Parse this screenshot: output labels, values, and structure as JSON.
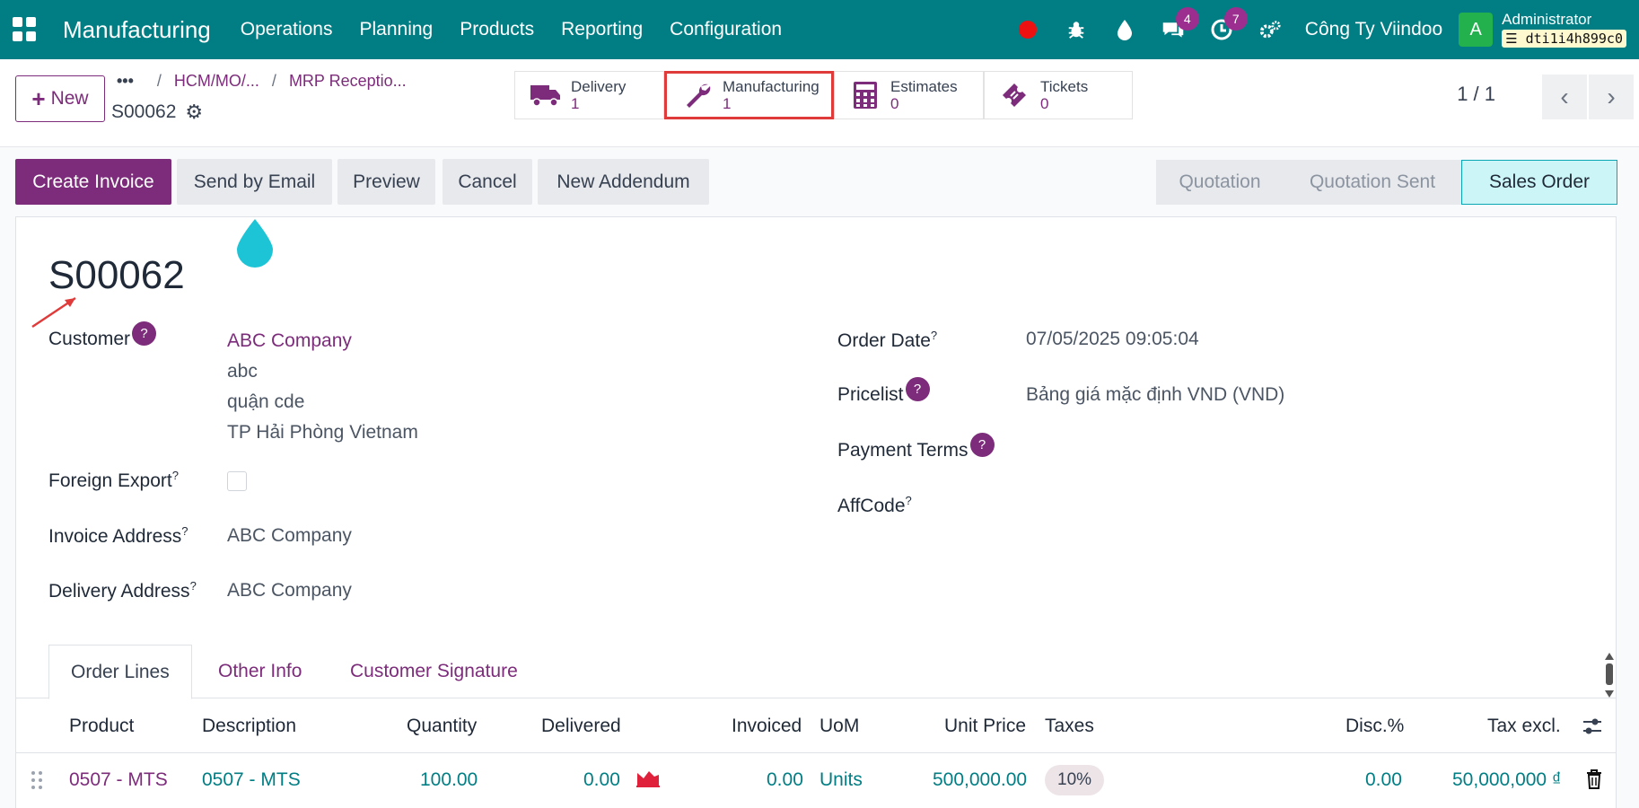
{
  "navbar": {
    "app_title": "Manufacturing",
    "menu": [
      "Operations",
      "Planning",
      "Products",
      "Reporting",
      "Configuration"
    ],
    "chat_badge": "4",
    "activity_badge": "7",
    "company": "Công Ty Viindoo",
    "avatar_letter": "A",
    "user": "Administrator",
    "database": "dti1i4h899c0"
  },
  "control": {
    "new_label": "New",
    "breadcrumb": [
      "HCM/MO/...",
      "MRP Receptio..."
    ],
    "record": "S00062",
    "pager": "1 / 1"
  },
  "smart_buttons": [
    {
      "label": "Delivery",
      "value": "1",
      "icon": "truck-icon"
    },
    {
      "label": "Manufacturing",
      "value": "1",
      "icon": "wrench-icon"
    },
    {
      "label": "Estimates",
      "value": "0",
      "icon": "calculator-icon"
    },
    {
      "label": "Tickets",
      "value": "0",
      "icon": "ticket-icon"
    }
  ],
  "actions": {
    "create_invoice": "Create Invoice",
    "send_email": "Send by Email",
    "preview": "Preview",
    "cancel": "Cancel",
    "new_addendum": "New Addendum"
  },
  "statusbar": [
    "Quotation",
    "Quotation Sent",
    "Sales Order"
  ],
  "form": {
    "title": "S00062",
    "customer_label": "Customer",
    "customer_name": "ABC Company",
    "customer_addr": [
      "abc",
      "quận cde",
      "TP Hải Phòng Vietnam"
    ],
    "foreign_export_label": "Foreign Export",
    "invoice_address_label": "Invoice Address",
    "invoice_address": "ABC Company",
    "delivery_address_label": "Delivery Address",
    "delivery_address": "ABC Company",
    "order_date_label": "Order Date",
    "order_date": "07/05/2025 09:05:04",
    "pricelist_label": "Pricelist",
    "pricelist": "Bảng giá mặc định VND (VND)",
    "payment_terms_label": "Payment Terms",
    "affcode_label": "AffCode",
    "help_mark": "?"
  },
  "tabs": [
    "Order Lines",
    "Other Info",
    "Customer Signature"
  ],
  "table": {
    "headers": [
      "Product",
      "Description",
      "Quantity",
      "Delivered",
      "Invoiced",
      "UoM",
      "Unit Price",
      "Taxes",
      "Disc.%",
      "Tax excl."
    ],
    "rows": [
      {
        "product": "0507 - MTS",
        "description": "0507 - MTS",
        "quantity": "100.00",
        "delivered": "0.00",
        "invoiced": "0.00",
        "uom": "Units",
        "unit_price": "500,000.00",
        "tax": "10%",
        "discount": "0.00",
        "subtotal": "50,000,000 ₫"
      }
    ]
  },
  "colors": {
    "navbar": "#017e84",
    "primary": "#7c2c7a",
    "highlight_border": "#e03b3b"
  }
}
